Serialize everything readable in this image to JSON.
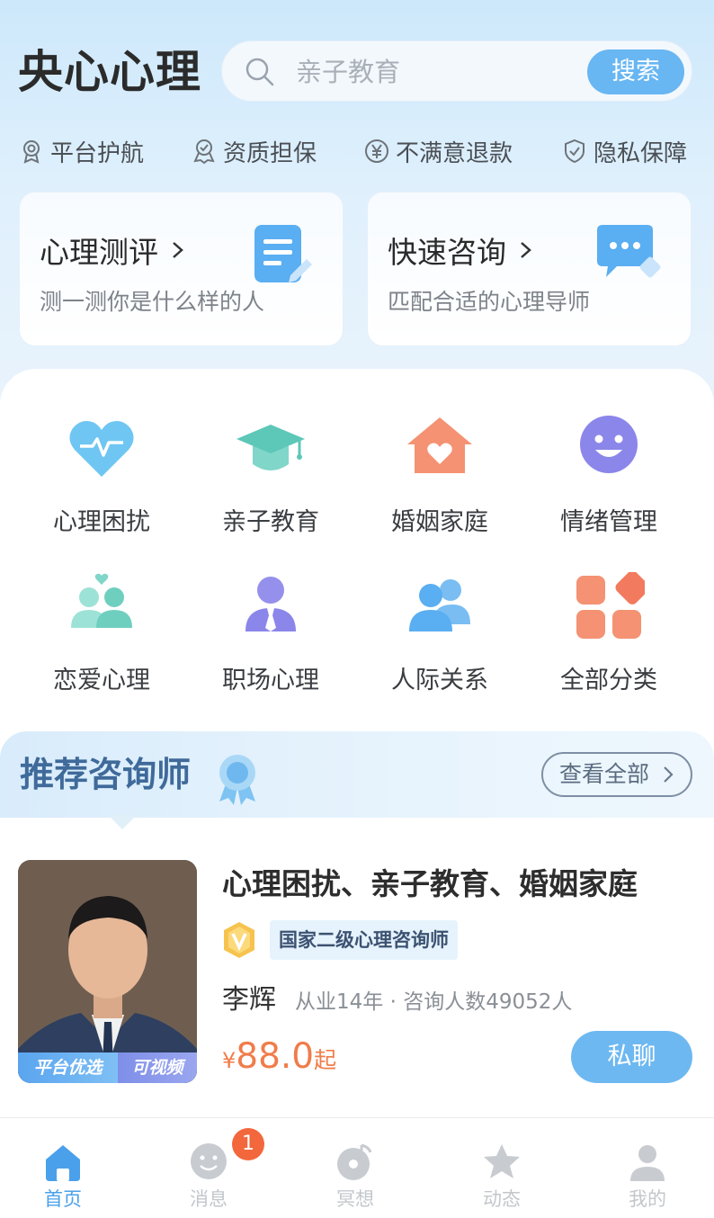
{
  "app": {
    "title": "央心心理"
  },
  "search": {
    "placeholder": "亲子教育",
    "button_label": "搜索"
  },
  "guarantees": [
    {
      "label": "平台护航",
      "icon": "award-ribbon-icon"
    },
    {
      "label": "资质担保",
      "icon": "certificate-badge-icon"
    },
    {
      "label": "不满意退款",
      "icon": "yen-circle-icon"
    },
    {
      "label": "隐私保障",
      "icon": "shield-check-icon"
    }
  ],
  "feature_cards": [
    {
      "title": "心理测评",
      "subtitle": "测一测你是什么样的人",
      "icon": "test-form-icon"
    },
    {
      "title": "快速咨询",
      "subtitle": "匹配合适的心理导师",
      "icon": "chat-bubble-icon"
    }
  ],
  "categories": [
    {
      "label": "心理困扰",
      "icon": "heart-pulse-icon"
    },
    {
      "label": "亲子教育",
      "icon": "graduation-cap-icon"
    },
    {
      "label": "婚姻家庭",
      "icon": "house-heart-icon"
    },
    {
      "label": "情绪管理",
      "icon": "smiley-face-icon"
    },
    {
      "label": "恋爱心理",
      "icon": "couple-heart-icon"
    },
    {
      "label": "职场心理",
      "icon": "businessperson-icon"
    },
    {
      "label": "人际关系",
      "icon": "people-group-icon"
    },
    {
      "label": "全部分类",
      "icon": "grid-categories-icon"
    }
  ],
  "recommend": {
    "title": "推荐咨询师",
    "view_all_label": "查看全部"
  },
  "counselor": {
    "specialties": "心理困扰、亲子教育、婚姻家庭",
    "certification": "国家二级心理咨询师",
    "name": "李辉",
    "meta": "从业14年 · 咨询人数49052人",
    "price_currency": "¥",
    "price_value": "88.0",
    "price_suffix": "起",
    "tags": [
      "平台优选",
      "可视频"
    ],
    "chat_label": "私聊"
  },
  "tabbar": {
    "items": [
      {
        "label": "首页",
        "icon": "home-icon",
        "active": true
      },
      {
        "label": "消息",
        "icon": "message-icon",
        "active": false,
        "badge": "1"
      },
      {
        "label": "冥想",
        "icon": "meditation-disc-icon",
        "active": false
      },
      {
        "label": "动态",
        "icon": "star-feed-icon",
        "active": false
      },
      {
        "label": "我的",
        "icon": "profile-icon",
        "active": false
      }
    ]
  },
  "colors": {
    "accent": "#68b6f2",
    "price": "#f07c4a",
    "badge": "#f3673c",
    "tab_active": "#4aa0ea"
  }
}
